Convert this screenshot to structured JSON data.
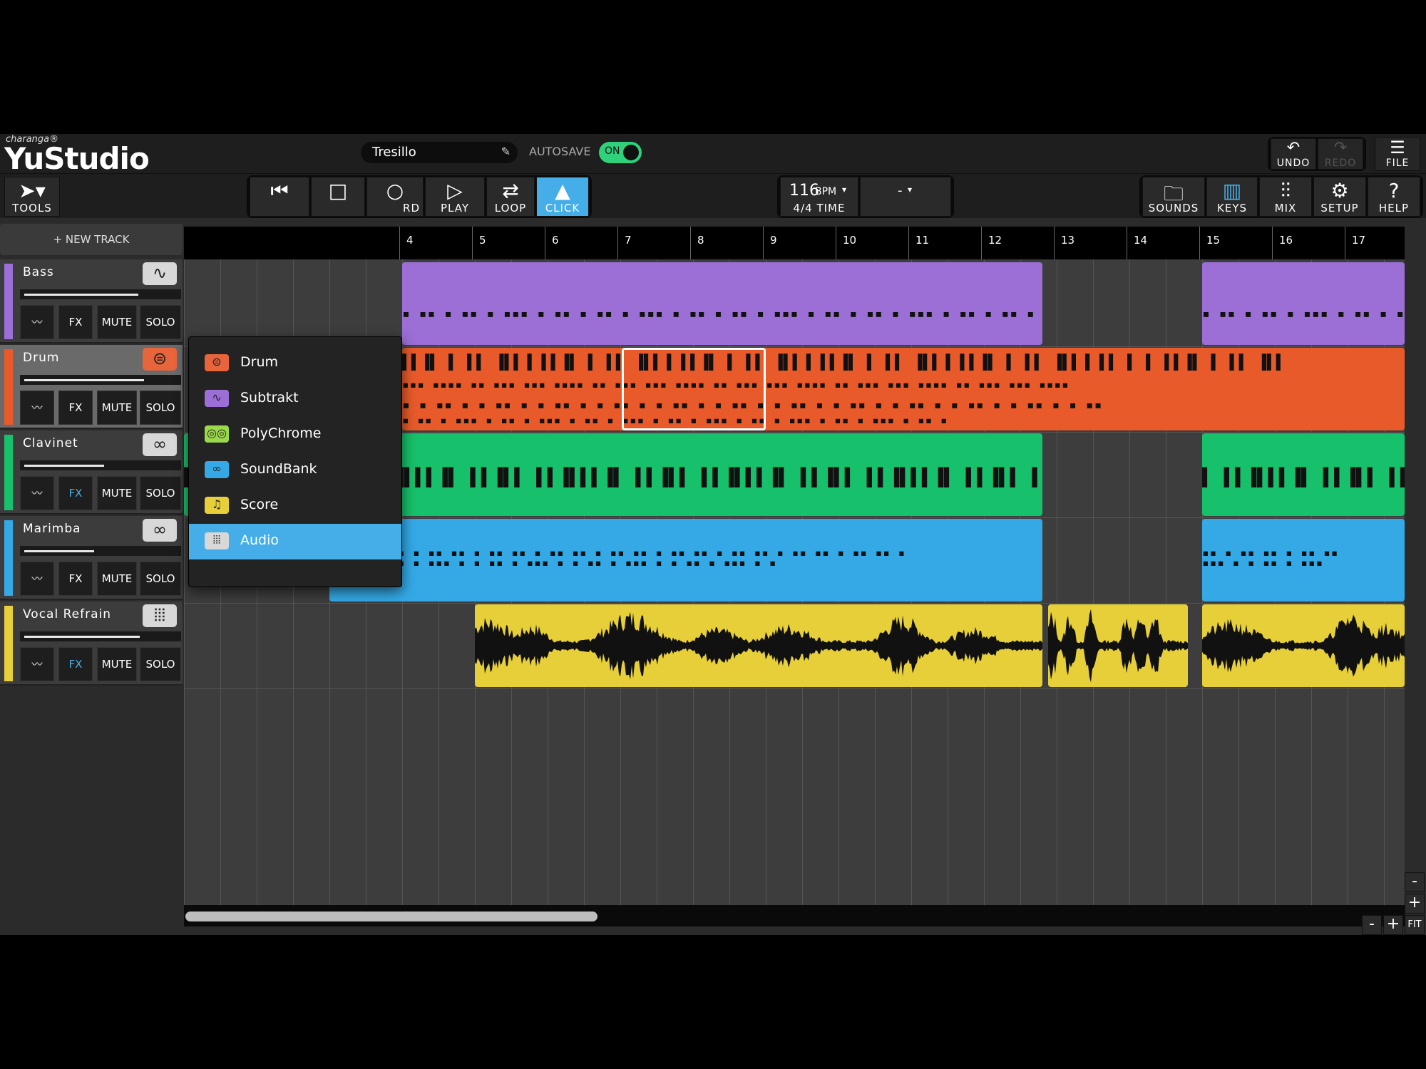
{
  "brand": {
    "small": "charanga®",
    "name": "YuStudio"
  },
  "song": {
    "title": "Tresillo"
  },
  "autosave": {
    "label": "AUTOSAVE",
    "state": "ON"
  },
  "top_buttons": {
    "undo": "UNDO",
    "redo": "REDO",
    "file": "FILE"
  },
  "toolbar": {
    "tools": "TOOLS",
    "record_partial": "RD",
    "play": "PLAY",
    "loop": "LOOP",
    "click": "CLICK",
    "tempo": "116",
    "tempo_unit": "BPM",
    "time_sig": "4/4 TIME",
    "key": "-",
    "sounds": "SOUNDS",
    "keys": "KEYS",
    "mix": "MIX",
    "setup": "SETUP",
    "help": "HELP"
  },
  "new_track": "+ NEW TRACK",
  "track_buttons": {
    "fx": "FX",
    "mute": "MUTE",
    "solo": "SOLO"
  },
  "tracks": [
    {
      "name": "Bass",
      "color": "#9b6fd6",
      "icon": "subtrakt-wave-icon",
      "volume": 0.55,
      "fx_active": false
    },
    {
      "name": "Drum",
      "color": "#e85a2a",
      "icon": "drum-icon",
      "volume": 0.6,
      "fx_active": false
    },
    {
      "name": "Clavinet",
      "color": "#17c06a",
      "icon": "soundbank-loop-icon",
      "volume": 0.4,
      "fx_active": true
    },
    {
      "name": "Marimba",
      "color": "#34a9e6",
      "icon": "soundbank-loop-icon",
      "volume": 0.35,
      "fx_active": false
    },
    {
      "name": "Vocal Refrain",
      "color": "#e7cf3a",
      "icon": "audio-waveform-icon",
      "volume": 0.6,
      "fx_active": true
    }
  ],
  "ruler": {
    "bars": [
      "4",
      "5",
      "6",
      "7",
      "8",
      "9",
      "10",
      "11",
      "12",
      "13",
      "14",
      "15",
      "16",
      "17"
    ]
  },
  "add_track_menu": {
    "items": [
      {
        "label": "Drum",
        "color": "#e8643a",
        "icon": "drum-icon"
      },
      {
        "label": "Subtrakt",
        "color": "#9b6fd6",
        "icon": "subtrakt-wave-icon"
      },
      {
        "label": "PolyChrome",
        "color": "#9bd94a",
        "icon": "polychrome-rings-icon"
      },
      {
        "label": "SoundBank",
        "color": "#34a9e6",
        "icon": "soundbank-loop-icon"
      },
      {
        "label": "Score",
        "color": "#e7cf3a",
        "icon": "score-notes-icon"
      },
      {
        "label": "Audio",
        "color": "#d8d8d8",
        "icon": "audio-waveform-icon"
      }
    ],
    "selected": "Audio"
  },
  "zoom": {
    "minus": "-",
    "plus": "+",
    "fit": "FIT"
  },
  "colors": {
    "accent": "#45aee8",
    "toggle_on": "#2fd27a"
  }
}
